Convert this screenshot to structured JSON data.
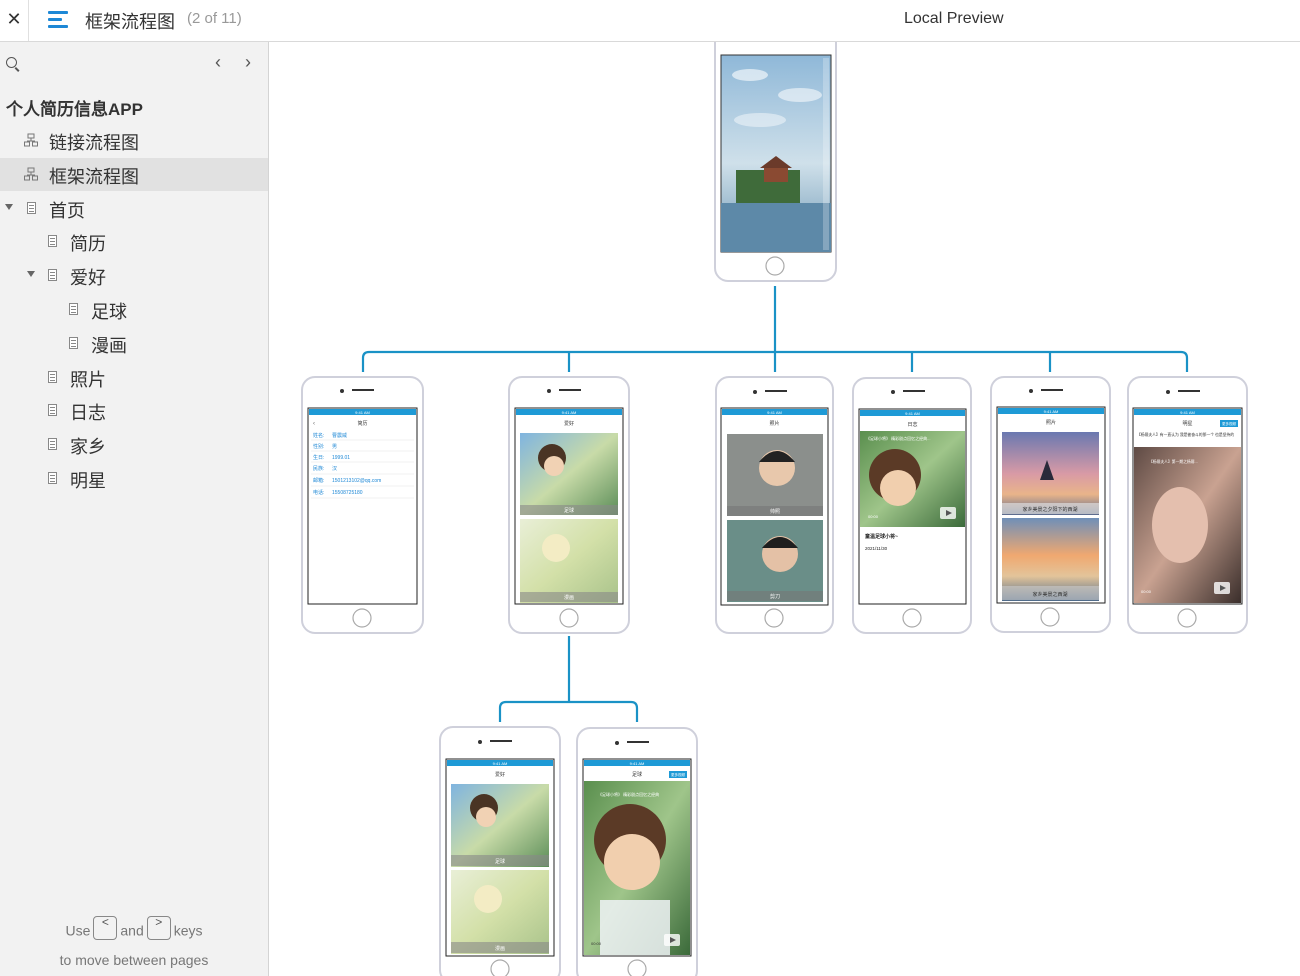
{
  "topbar": {
    "close_symbol": "✕",
    "menu_icon": "hamburger-menu-icon",
    "page_title": "框架流程图",
    "page_count": "(2 of 11)",
    "preview_title": "Local Preview"
  },
  "sidebar": {
    "search_icon": "search-icon",
    "prev_symbol": "‹",
    "next_symbol": "›",
    "project_title": "个人简历信息APP",
    "items": [
      {
        "label": "链接流程图",
        "type": "flow",
        "level": 0,
        "selected": false
      },
      {
        "label": "框架流程图",
        "type": "flow",
        "level": 0,
        "selected": true
      },
      {
        "label": "首页",
        "type": "page",
        "level": 0,
        "expanded": true
      },
      {
        "label": "简历",
        "type": "page",
        "level": 1
      },
      {
        "label": "爱好",
        "type": "page",
        "level": 1,
        "expanded": true
      },
      {
        "label": "足球",
        "type": "page",
        "level": 2
      },
      {
        "label": "漫画",
        "type": "page",
        "level": 2
      },
      {
        "label": "照片",
        "type": "page",
        "level": 1
      },
      {
        "label": "日志",
        "type": "page",
        "level": 1
      },
      {
        "label": "家乡",
        "type": "page",
        "level": 1
      },
      {
        "label": "明星",
        "type": "page",
        "level": 1
      }
    ],
    "hint": {
      "use": "Use",
      "and": "and",
      "keys": "keys",
      "line2": "to move between pages",
      "key_prev": "<",
      "key_next": ">"
    }
  },
  "phones": {
    "resume": {
      "title": "简历",
      "fields": [
        {
          "label": "姓名:",
          "value": "曹震威"
        },
        {
          "label": "性别:",
          "value": "男"
        },
        {
          "label": "生日:",
          "value": "1999.01"
        },
        {
          "label": "民族:",
          "value": "汉"
        },
        {
          "label": "邮箱:",
          "value": "1501213102@qq.com"
        },
        {
          "label": "电话:",
          "value": "15508725180"
        }
      ]
    },
    "hobby": {
      "title": "爱好",
      "cap1": "足球",
      "cap2": "漫画"
    },
    "photos": {
      "title": "照片",
      "cap1": "帅照",
      "cap2": "剪刀"
    },
    "diary": {
      "title": "日志",
      "post_title": "童温足球小将~",
      "date": "2021/11/30",
      "caption": "《足球小将》 精彩剧点回忆之经典..."
    },
    "hometown": {
      "title": "照片",
      "cap1": "家乡美景之夕阳下的西湖",
      "cap2": "家乡美景之西湖"
    },
    "star": {
      "title": "明星",
      "badge": "更多视频",
      "intro": "【杨幂夫人】有一直认为 我是被奋斗的那一个 也是坚持的",
      "video_title": "【杨幂夫人】第一期之杨幂..."
    },
    "hobby2": {
      "title": "爱好",
      "cap1": "足球",
      "cap2": "漫画"
    },
    "football": {
      "title": "足球",
      "badge": "更多视频",
      "intro": "《足球小将》 精彩剧点回忆之经典"
    },
    "status_time": "9:41 AM",
    "battery": "100%",
    "video_time": "00:00"
  },
  "colors": {
    "connector": "#1a92c6",
    "status_bar": "#1e9ad6",
    "phone_frame": "#cfd0db",
    "selected_row": "#e1e1e1"
  }
}
